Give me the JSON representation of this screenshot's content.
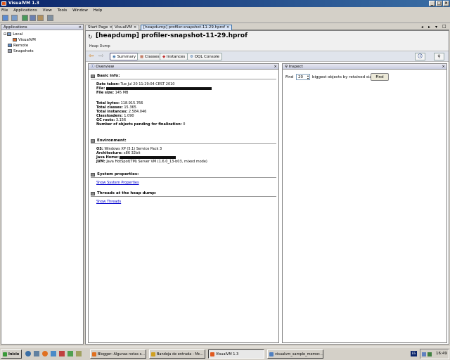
{
  "window": {
    "title": "VisualVM 1.3"
  },
  "menu": [
    "File",
    "Applications",
    "View",
    "Tools",
    "Window",
    "Help"
  ],
  "left": {
    "title": "Applications",
    "tree": [
      {
        "label": "Local"
      },
      {
        "label": "VisualVM"
      },
      {
        "label": "Remote"
      },
      {
        "label": "Snapshots"
      }
    ]
  },
  "tabs": [
    "Start Page",
    "VisualVM",
    "[heapdump] profiler-snapshot-11-29.hprof"
  ],
  "doc": {
    "title": "[heapdump] profiler-snapshot-11-29.hprof",
    "subtitle": "Heap Dump"
  },
  "views": [
    "Summary",
    "Classes",
    "Instances",
    "OQL Console"
  ],
  "overview": {
    "title": "Overview",
    "basic": {
      "heading": "Basic info:",
      "date": {
        "label": "Date taken:",
        "value": "Tue Jul 20 11:29:04 CEST 2010"
      },
      "file": {
        "label": "File:"
      },
      "size": {
        "label": "File size:",
        "value": "145 MB"
      },
      "bytes": {
        "label": "Total bytes:",
        "value": "118.915.766"
      },
      "classes": {
        "label": "Total classes:",
        "value": "15.365"
      },
      "instances": {
        "label": "Total instances:",
        "value": "2.584.046"
      },
      "loaders": {
        "label": "Classloaders:",
        "value": "1.090"
      },
      "gc": {
        "label": "GC roots:",
        "value": "3.156"
      },
      "pending": {
        "label": "Number of objects pending for finalization:",
        "value": "0"
      }
    },
    "env": {
      "heading": "Environment:",
      "os": {
        "label": "OS:",
        "value": "Windows XP (5.1) Service Pack 3"
      },
      "arch": {
        "label": "Architecture:",
        "value": "x86 32bit"
      },
      "home": {
        "label": "Java Home:"
      },
      "jvm": {
        "label": "JVM:",
        "value": "Java HotSpot(TM) Server VM (1.6.0_13-b03, mixed mode)"
      }
    },
    "sysprops": {
      "heading": "System properties:",
      "link": "Show System Properties"
    },
    "threads": {
      "heading": "Threads at the heap dump:",
      "link": "Show Threads"
    }
  },
  "inspect": {
    "title": "Inspect",
    "find_label": "Find",
    "count": "20",
    "suffix": "biggest objects by retained size:",
    "button": "Find"
  },
  "taskbar": {
    "start": "Inicio",
    "tasks": [
      "Blogger: Algunas notas s...",
      "Bandeja de entrada - Mc...",
      "VisualVM 1.3",
      "visualvm_sample_memor..."
    ],
    "clock": "16:49"
  }
}
